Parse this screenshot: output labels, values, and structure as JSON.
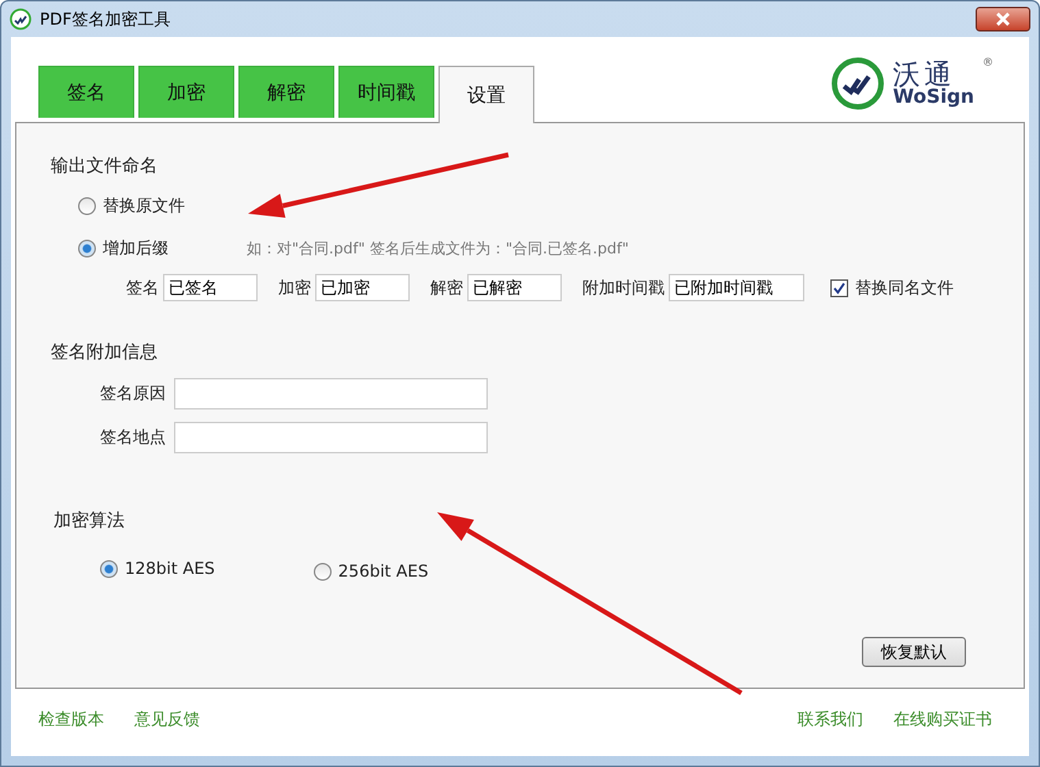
{
  "window": {
    "title": "PDF签名加密工具"
  },
  "logo": {
    "name_cn": "沃通",
    "name_en": "WoSign",
    "mark": "®"
  },
  "tabs": [
    {
      "label": "签名",
      "selected": false
    },
    {
      "label": "加密",
      "selected": false
    },
    {
      "label": "解密",
      "selected": false
    },
    {
      "label": "时间戳",
      "selected": false
    },
    {
      "label": "设置",
      "selected": true
    }
  ],
  "output_naming": {
    "heading": "输出文件命名",
    "options": [
      {
        "label": "替换原文件",
        "selected": false
      },
      {
        "label": "增加后缀",
        "selected": true
      }
    ],
    "hint": "如：对\"合同.pdf\" 签名后生成文件为：\"合同.已签名.pdf\"",
    "suffixes": [
      {
        "label": "签名",
        "value": "已签名"
      },
      {
        "label": "加密",
        "value": "已加密"
      },
      {
        "label": "解密",
        "value": "已解密"
      },
      {
        "label": "附加时间戳",
        "value": "已附加时间戳"
      }
    ],
    "overwrite": {
      "label": "替换同名文件",
      "checked": true
    }
  },
  "signature_info": {
    "heading": "签名附加信息",
    "fields": [
      {
        "label": "签名原因"
      },
      {
        "label": "签名地点"
      }
    ]
  },
  "encryption": {
    "heading": "加密算法",
    "options": [
      {
        "label": "128bit AES",
        "selected": true
      },
      {
        "label": "256bit AES",
        "selected": false
      }
    ]
  },
  "restore_button": "恢复默认",
  "footer_left": [
    "检查版本",
    "意见反馈"
  ],
  "footer_right": [
    "联系我们",
    "在线购买证书"
  ]
}
